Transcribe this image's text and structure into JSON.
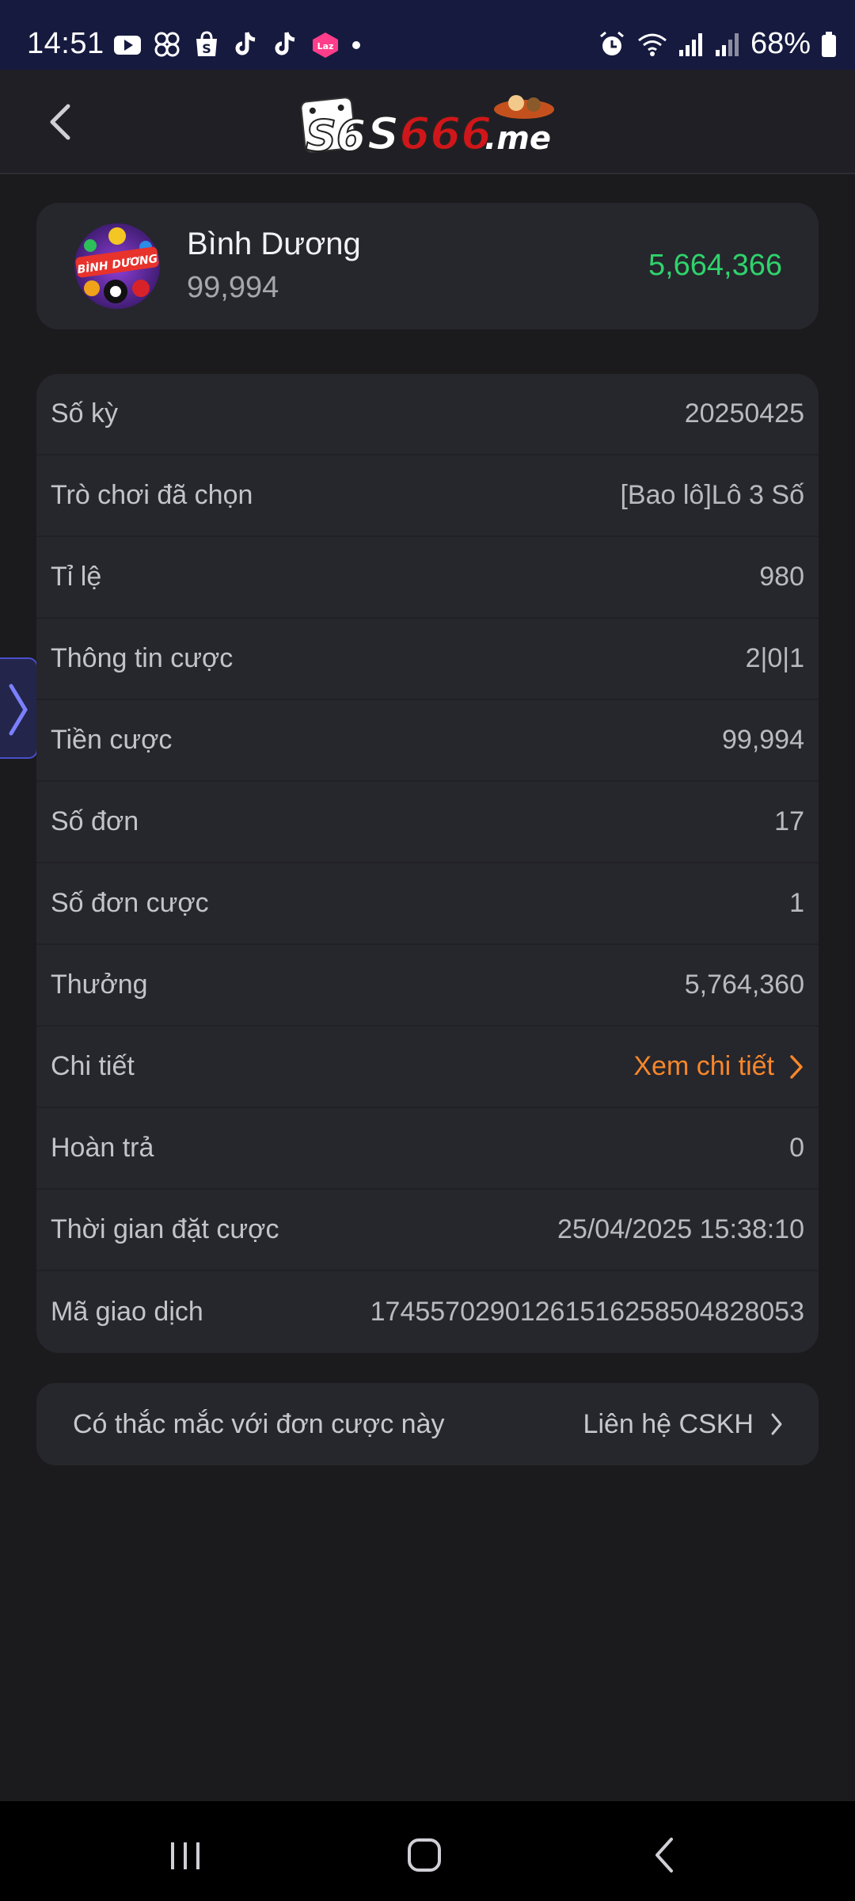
{
  "status_bar": {
    "time": "14:51",
    "battery": "68%",
    "left_icons": [
      "youtube-icon",
      "pinwheel-icon",
      "shopee-icon",
      "tiktok-icon",
      "tiktok-icon",
      "lazada-icon",
      "dot-icon"
    ],
    "right_icons": [
      "alarm-icon",
      "wifi-icon",
      "signal-icon",
      "signal-icon",
      "battery-icon"
    ]
  },
  "header": {
    "logo_text_left": "S6",
    "logo_text_mid": "S666",
    "logo_text_right": ".me"
  },
  "summary": {
    "badge_text": "BÌNH DƯƠNG",
    "name": "Bình Dương",
    "stake": "99,994",
    "winnings": "5,664,366"
  },
  "details": {
    "rows": [
      {
        "label": "Số kỳ",
        "value": "20250425"
      },
      {
        "label": "Trò chơi đã chọn",
        "value": "[Bao lô]Lô 3 Số"
      },
      {
        "label": "Tỉ lệ",
        "value": "980"
      },
      {
        "label": "Thông tin cược",
        "value": "2|0|1"
      },
      {
        "label": "Tiền cược",
        "value": "99,994"
      },
      {
        "label": "Số đơn",
        "value": "17"
      },
      {
        "label": "Số đơn cược",
        "value": "1"
      },
      {
        "label": "Thưởng",
        "value": "5,764,360"
      },
      {
        "label": "Chi tiết",
        "value": "Xem chi tiết"
      },
      {
        "label": "Hoàn trả",
        "value": "0"
      },
      {
        "label": "Thời gian đặt cược",
        "value": "25/04/2025 15:38:10"
      },
      {
        "label": "Mã giao dịch",
        "value": "17455702901261516258504828053"
      }
    ]
  },
  "help": {
    "question": "Có thắc mắc với đơn cược này",
    "link": "Liên hệ CSKH"
  },
  "colors": {
    "winnings": "#2fd36b",
    "link": "#f7872a",
    "status_bar_bg": "#161a3f",
    "card_bg": "#26262d",
    "page_bg": "#1b1b1d"
  }
}
